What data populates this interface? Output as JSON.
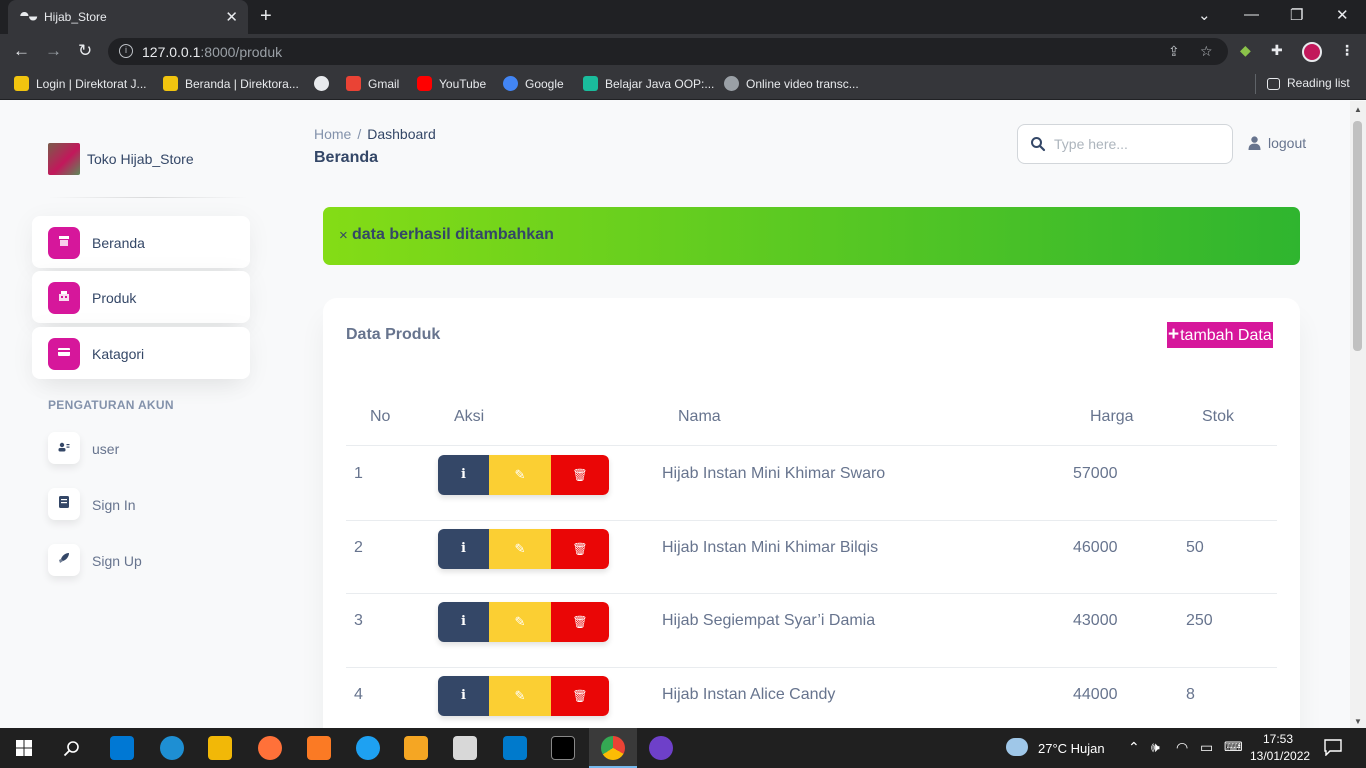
{
  "browser": {
    "tab_title": "Hijab_Store",
    "tab_close": "✕",
    "new_tab": "+",
    "url_host": "127.0.0.1",
    "url_rest": ":8000/produk",
    "bookmarks": [
      {
        "label": "Login | Direktorat J...",
        "color": "#f1c40f"
      },
      {
        "label": "Beranda | Direktora...",
        "color": "#f1c40f"
      },
      {
        "label": "",
        "color": "#e8eaed"
      },
      {
        "label": "Gmail",
        "color": "#ea4335"
      },
      {
        "label": "YouTube",
        "color": "#ff0000"
      },
      {
        "label": "Google",
        "color": "#4285f4"
      },
      {
        "label": "Belajar Java OOP:...",
        "color": "#1abc9c"
      },
      {
        "label": "Online video transc...",
        "color": "#9aa0a6"
      }
    ],
    "reading_list": "Reading list"
  },
  "sidebar": {
    "brand": "Toko Hijab_Store",
    "items": [
      {
        "label": "Beranda",
        "icon": "shop-icon"
      },
      {
        "label": "Produk",
        "icon": "office-icon"
      },
      {
        "label": "Katagori",
        "icon": "card-icon"
      }
    ],
    "section_heading": "PENGATURAN AKUN",
    "account_items": [
      {
        "label": "user",
        "icon": "user-icon"
      },
      {
        "label": "Sign In",
        "icon": "document-icon"
      },
      {
        "label": "Sign Up",
        "icon": "rocket-icon"
      }
    ]
  },
  "header": {
    "breadcrumb_home": "Home",
    "breadcrumb_sep": "/",
    "breadcrumb_current": "Dashboard",
    "title": "Beranda",
    "search_placeholder": "Type here...",
    "logout": "logout"
  },
  "alert": {
    "close": "×",
    "message": "data berhasil ditambahkan",
    "colors": [
      "#84dc16",
      "#2fb52f"
    ]
  },
  "card": {
    "title": "Data Produk",
    "add_button": "tambah Data",
    "accent": "#d6179b",
    "columns": [
      "No",
      "Aksi",
      "Nama",
      "Harga",
      "Stok"
    ],
    "rows": [
      {
        "no": "1",
        "nama": "Hijab Instan Mini Khimar Swaro",
        "harga": "57000",
        "stok": ""
      },
      {
        "no": "2",
        "nama": "Hijab Instan Mini Khimar Bilqis",
        "harga": "46000",
        "stok": "50"
      },
      {
        "no": "3",
        "nama": "Hijab Segiempat Syar’i Damia",
        "harga": "43000",
        "stok": "250"
      },
      {
        "no": "4",
        "nama": "Hijab Instan Alice Candy",
        "harga": "44000",
        "stok": "8"
      }
    ],
    "action_buttons": {
      "info": "i",
      "edit": "✎",
      "delete": "🗑"
    }
  },
  "taskbar": {
    "weather": "27°C  Hujan",
    "time": "17:53",
    "date": "13/01/2022"
  }
}
